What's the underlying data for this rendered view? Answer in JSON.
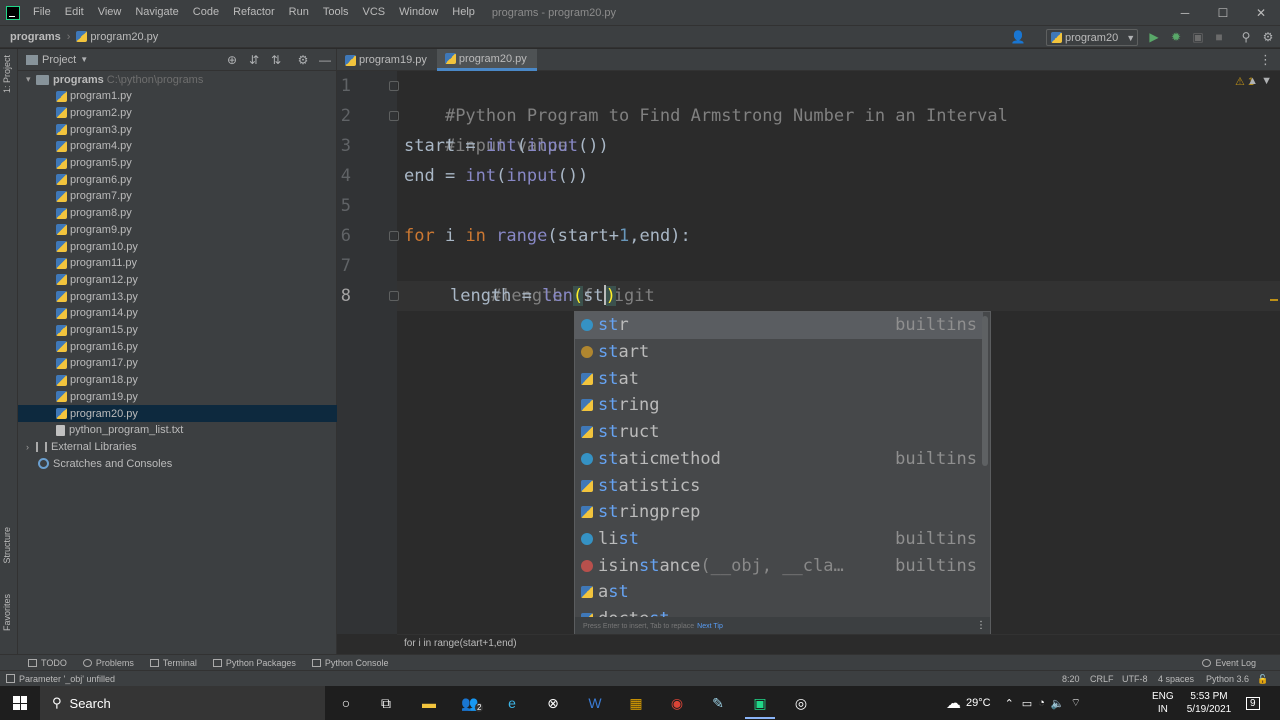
{
  "menubar": {
    "items": [
      "File",
      "Edit",
      "View",
      "Navigate",
      "Code",
      "Refactor",
      "Run",
      "Tools",
      "VCS",
      "Window",
      "Help"
    ],
    "window_title": "programs - program20.py",
    "minimize": "─",
    "maximize": "☐",
    "close": "✕"
  },
  "navbar": {
    "project": "programs",
    "file": "program20.py",
    "run_config": "program20"
  },
  "stripe": {
    "project": "1: Project",
    "structure": "Structure",
    "favorites": "Favorites"
  },
  "project_panel": {
    "title": "Project",
    "root": "programs",
    "root_path": "C:\\python\\programs",
    "files": [
      "program1.py",
      "program2.py",
      "program3.py",
      "program4.py",
      "program5.py",
      "program6.py",
      "program7.py",
      "program8.py",
      "program9.py",
      "program10.py",
      "program11.py",
      "program12.py",
      "program13.py",
      "program14.py",
      "program15.py",
      "program16.py",
      "program17.py",
      "program18.py",
      "program19.py",
      "program20.py"
    ],
    "selected_file": "program20.py",
    "txt_file": "python_program_list.txt",
    "external_libraries": "External Libraries",
    "scratches": "Scratches and Consoles"
  },
  "tabs": [
    {
      "label": "program19.py",
      "active": false
    },
    {
      "label": "program20.py",
      "active": true
    }
  ],
  "editor": {
    "line_numbers": [
      "1",
      "2",
      "3",
      "4",
      "5",
      "6",
      "7",
      "8"
    ],
    "current_line": "8",
    "lines": {
      "l1": "#Python Program to Find Armstrong Number in an Interval",
      "l2": "#input value",
      "l3_var": "start = ",
      "l3_int": "int",
      "l3_open": "(",
      "l3_input": "input",
      "l3_close": "())",
      "l4_var": "end = ",
      "l4_int": "int",
      "l4_open": "(",
      "l4_input": "input",
      "l4_close": "())",
      "l6_for": "for",
      "l6_i": " i ",
      "l6_in": "in",
      "l6_sp": " ",
      "l6_range": "range",
      "l6_args_a": "(start+",
      "l6_num": "1",
      "l6_args_b": ",end):",
      "l7": "#length of digit",
      "l8_a": "length = ",
      "l8_len": "len",
      "l8_paren": "(",
      "l8_typed": "st",
      "l8_close": ")"
    },
    "warning_count": "1",
    "crumb": "for i in range(start+1,end)"
  },
  "completion": {
    "items": [
      {
        "icon": "class",
        "match": "st",
        "rest": "r",
        "extra": "",
        "tail": "builtins"
      },
      {
        "icon": "var",
        "match": "st",
        "rest": "art",
        "extra": "",
        "tail": ""
      },
      {
        "icon": "module",
        "match": "st",
        "rest": "at",
        "extra": "",
        "tail": ""
      },
      {
        "icon": "module",
        "match": "st",
        "rest": "ring",
        "extra": "",
        "tail": ""
      },
      {
        "icon": "module",
        "match": "st",
        "rest": "ruct",
        "extra": "",
        "tail": ""
      },
      {
        "icon": "class",
        "match": "st",
        "rest": "aticmethod",
        "extra": "",
        "tail": "builtins"
      },
      {
        "icon": "module",
        "match": "st",
        "rest": "atistics",
        "extra": "",
        "tail": ""
      },
      {
        "icon": "module",
        "match": "st",
        "rest": "ringprep",
        "extra": "",
        "tail": ""
      },
      {
        "icon": "class",
        "pre": "li",
        "match": "st",
        "rest": "",
        "extra": "",
        "tail": "builtins"
      },
      {
        "icon": "func",
        "pre": "isin",
        "match": "st",
        "rest": "ance",
        "extra": "(__obj, __cla…",
        "tail": "builtins"
      },
      {
        "icon": "module",
        "pre": "a",
        "match": "st",
        "rest": "",
        "extra": "",
        "tail": ""
      },
      {
        "icon": "module",
        "pre": "docte",
        "match": "st",
        "rest": "",
        "extra": "",
        "tail": ""
      }
    ],
    "footer": "Press Enter to insert, Tab to replace",
    "footer_link": "Next Tip"
  },
  "tool_windows": {
    "todo": "TODO",
    "problems": "Problems",
    "terminal": "Terminal",
    "python_packages": "Python Packages",
    "python_console": "Python Console",
    "event_log": "Event Log"
  },
  "statusbar": {
    "message": "Parameter '_obj' unfilled",
    "position": "8:20",
    "line_sep": "CRLF",
    "encoding": "UTF-8",
    "indent": "4 spaces",
    "interpreter": "Python 3.6"
  },
  "taskbar": {
    "search": "Search",
    "edge_badge": "2",
    "temperature": "29°C",
    "lang": "ENG",
    "region": "IN",
    "time": "5:53 PM",
    "date": "5/19/2021",
    "notifications": "9"
  }
}
